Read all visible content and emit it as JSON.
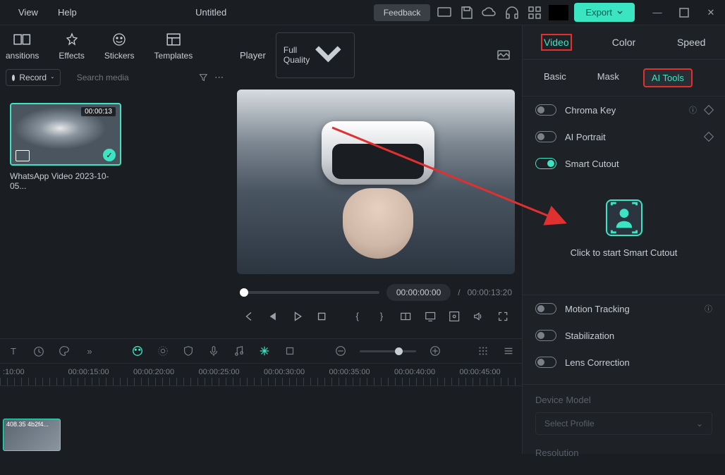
{
  "menu": {
    "view": "View",
    "help": "Help"
  },
  "title": "Untitled",
  "topbar": {
    "feedback": "Feedback",
    "export": "Export"
  },
  "media_tabs": {
    "transitions": "ansitions",
    "effects": "Effects",
    "stickers": "Stickers",
    "templates": "Templates"
  },
  "media_toolbar": {
    "record": "Record",
    "search_placeholder": "Search media"
  },
  "media_item": {
    "duration": "00:00:13",
    "name": "WhatsApp Video 2023-10-05..."
  },
  "player": {
    "label": "Player",
    "quality": "Full Quality",
    "time_current": "00:00:00:00",
    "time_separator": "/",
    "time_total": "00:00:13:20"
  },
  "timeline": {
    "marks": [
      ":10:00",
      "00:00:15:00",
      "00:00:20:00",
      "00:00:25:00",
      "00:00:30:00",
      "00:00:35:00",
      "00:00:40:00",
      "00:00:45:00"
    ],
    "clip_label": "408.35 4b2f4..."
  },
  "right": {
    "tabs": {
      "video": "Video",
      "color": "Color",
      "speed": "Speed"
    },
    "subtabs": {
      "basic": "Basic",
      "mask": "Mask",
      "ai_tools": "AI Tools"
    },
    "options": {
      "chroma_key": "Chroma Key",
      "ai_portrait": "AI Portrait",
      "smart_cutout": "Smart Cutout",
      "motion_tracking": "Motion Tracking",
      "stabilization": "Stabilization",
      "lens_correction": "Lens Correction"
    },
    "smart_text": "Click to start Smart Cutout",
    "device_model": "Device Model",
    "select_profile": "Select Profile",
    "resolution": "Resolution"
  }
}
